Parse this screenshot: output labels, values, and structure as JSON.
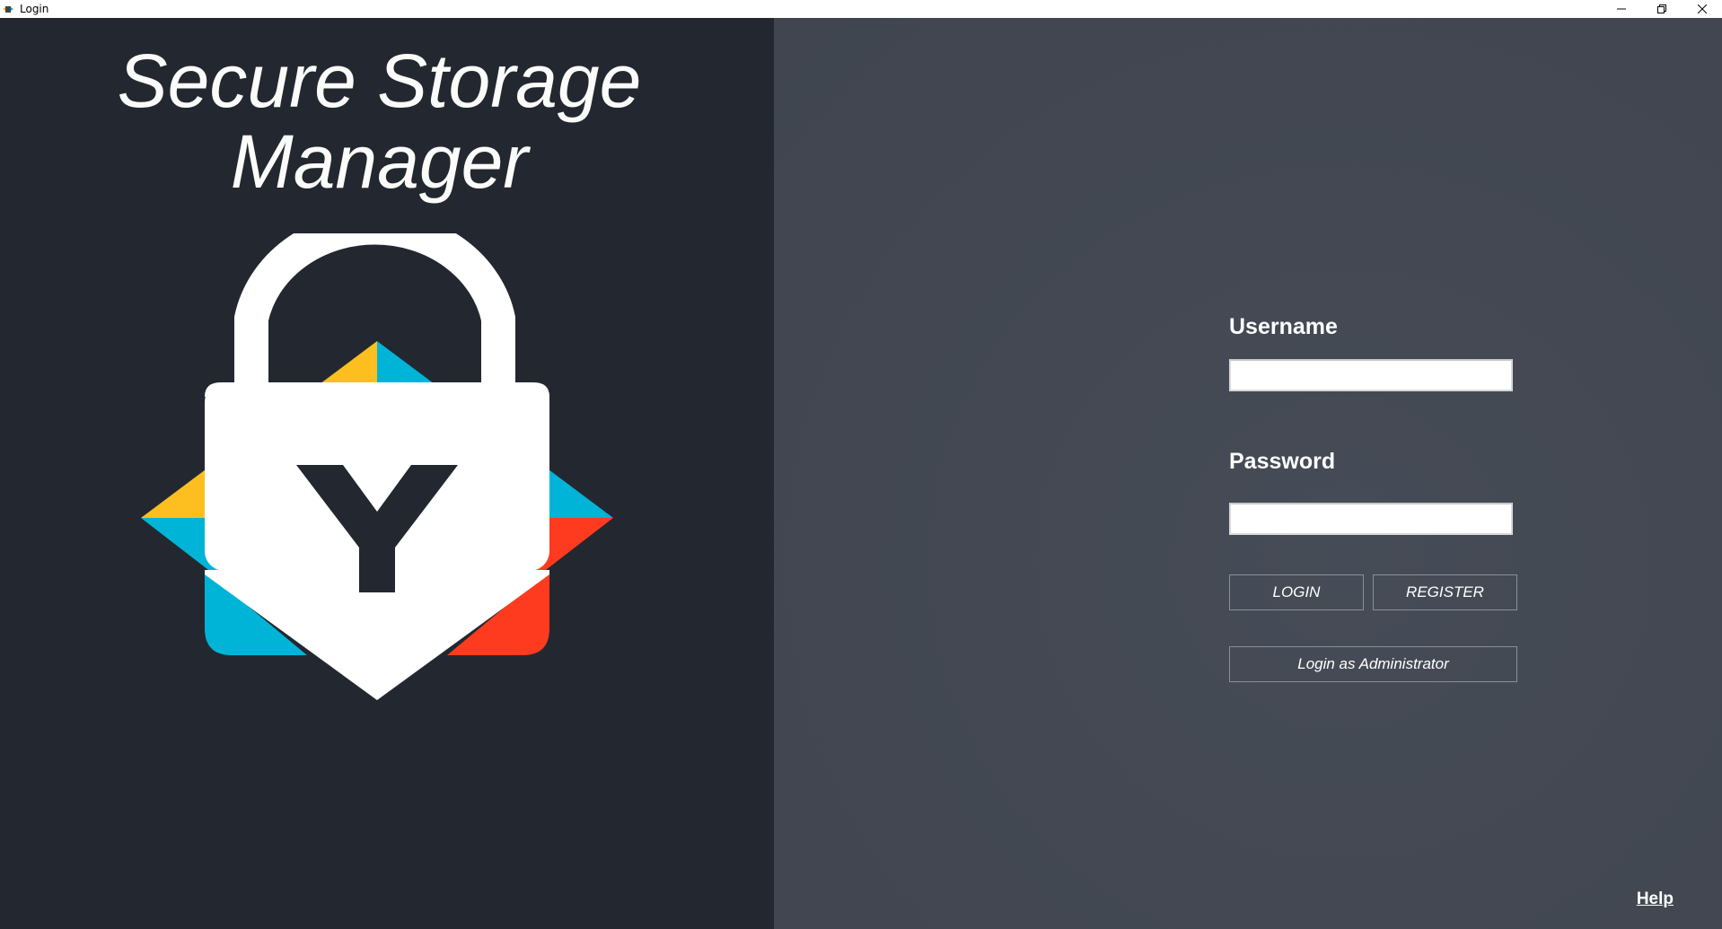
{
  "window": {
    "title": "Login"
  },
  "branding": {
    "title_line1": "Secure Storage",
    "title_line2": "Manager",
    "logo_letter": "Y",
    "colors": {
      "yellow": "#fdbf1f",
      "cyan": "#00b4d8",
      "red": "#ff3b1f",
      "lock": "#ffffff",
      "dark": "#232830"
    }
  },
  "form": {
    "username_label": "Username",
    "username_value": "",
    "password_label": "Password",
    "password_value": "",
    "login_button": "LOGIN",
    "register_button": "REGISTER",
    "admin_button": "Login as Administrator"
  },
  "footer": {
    "help_link": "Help"
  }
}
